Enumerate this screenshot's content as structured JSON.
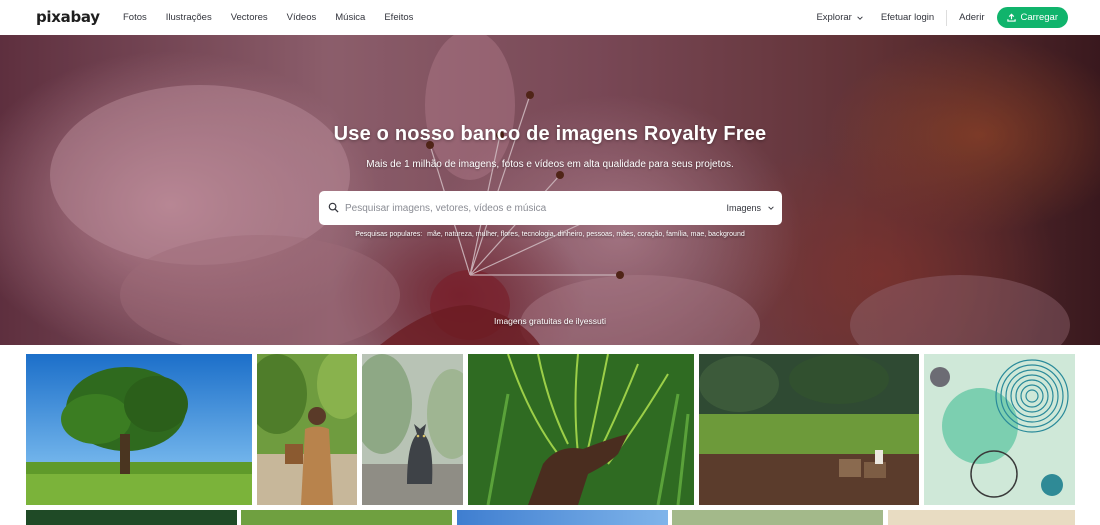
{
  "header": {
    "logo": "pixabay",
    "nav": [
      "Fotos",
      "Ilustrações",
      "Vectores",
      "Vídeos",
      "Música",
      "Efeitos"
    ],
    "explore": "Explorar",
    "login": "Efetuar login",
    "join": "Aderir",
    "upload": "Carregar"
  },
  "hero": {
    "title": "Use o nosso banco de imagens Royalty Free",
    "subtitle": "Mais de 1 milhão de imagens, fotos e vídeos em alta qualidade para seus projetos.",
    "search_placeholder": "Pesquisar imagens, vetores, vídeos e música",
    "search_type": "Imagens",
    "popular_label": "Pesquisas populares:",
    "popular_terms": [
      "mãe",
      "natureza",
      "mulher",
      "flores",
      "tecnologia",
      "dinheiro",
      "pessoas",
      "mães",
      "coração",
      "família",
      "mae",
      "background"
    ],
    "credit": "Imagens gratuitas de ilyessuti"
  },
  "colors": {
    "accent": "#10b46c",
    "text": "#33353d"
  },
  "icons": {
    "search": "search-icon",
    "upload": "upload-icon",
    "chevron": "chevron-down-icon"
  }
}
